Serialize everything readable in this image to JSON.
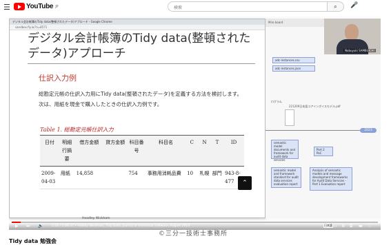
{
  "youtube": {
    "menu_icon": "hamburger-icon",
    "logo_text": "YouTube",
    "region": "JP",
    "search_placeholder": "検索",
    "search_icon": "search-icon",
    "mic_icon": "mic-icon"
  },
  "browser": {
    "tab_title": "デジタル会計帳簿のTidy data(整頓されたデータ)アプローチ - Google Chrome",
    "address": "sandbox.fly.io/?s=8571"
  },
  "slide": {
    "title": "デジタル会計帳簿のTidy data(整頓されたデータ)アプローチ",
    "section_heading": "仕訳入力例",
    "paragraph_1": "総勘定元帳の仕訳入力用にTidy data(整頓されたデータ)を定義する方法を検討します。",
    "paragraph_2": "次は、用紙を現金で購入したときの仕訳入力例です。",
    "table_caption": "Table 1. 総勘定元帳仕訳入力",
    "table": {
      "headers": [
        "日付",
        "明細行摘要",
        "借方金額",
        "貸方金額",
        "科目番号",
        "科目名",
        "C",
        "N",
        "T",
        "ID"
      ],
      "rows": [
        [
          "2009-04-03",
          "用紙",
          "14,858",
          "",
          "754",
          "事務用消耗品費",
          "10",
          "札幌",
          "部門",
          "943-8-477"
        ]
      ]
    }
  },
  "diagram": {
    "header_text": "Miro board",
    "box_1": "adc-instances.csv",
    "box_2": "adc-instances.json",
    "program_label": "ログラム",
    "file_label": "221209日本語コアインボイスモデル.pdf",
    "year_label": "2023",
    "box_3": "semantic model documents and framework for audit data services",
    "part2_box": "Part 2 PoC",
    "box_4": "semantic model and framework standard for audit data services evaluation report",
    "box_5": "Analysis of semantic models and message development frameworks for Audit Data Services - Part 1 Evaluation report"
  },
  "webcam": {
    "name": "Nobuyuki SAMBUICHI"
  },
  "bottom_label": "Headley Wickham",
  "player": {
    "time_text": "1:34 / 1:04:37 • Hadley Wickham, Tidy Data, Journal of Statistical Software, August 2014",
    "progress_fraction": 0.025,
    "language_badge": "日本語",
    "controls": [
      "play-icon",
      "next-icon",
      "volume-icon",
      "captions-icon",
      "settings-icon",
      "miniplayer-icon",
      "theater-icon",
      "fullscreen-icon"
    ]
  },
  "watermark": "©三分一技術士事務所",
  "video_title": "Tidy data 勉強会",
  "colors": {
    "youtube_red": "#ff0000",
    "heading_red": "#c0392b",
    "diagram_blue": "#8aa0d8"
  }
}
